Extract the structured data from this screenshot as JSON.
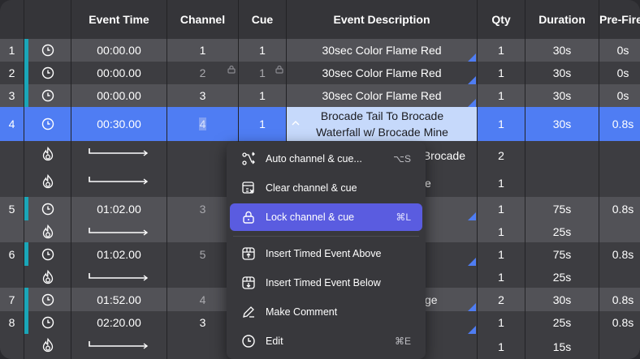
{
  "columns": [
    "",
    "",
    "Event Time",
    "Channel",
    "Cue",
    "Event Description",
    "Qty",
    "Duration",
    "Pre-Fire"
  ],
  "rows": [
    {
      "num": "1",
      "time": "00:00.00",
      "channel": "1",
      "cue": "1",
      "desc": "30sec Color Flame Red",
      "qty": "1",
      "duration": "30s",
      "prefire": "0s"
    },
    {
      "num": "2",
      "time": "00:00.00",
      "channel": "2",
      "cue": "1",
      "desc": "30sec Color Flame Red",
      "qty": "1",
      "duration": "30s",
      "prefire": "0s"
    },
    {
      "num": "3",
      "time": "00:00.00",
      "channel": "3",
      "cue": "1",
      "desc": "30sec Color Flame Red",
      "qty": "1",
      "duration": "30s",
      "prefire": "0s"
    },
    {
      "num": "4",
      "time": "00:30.00",
      "channel": "4",
      "cue": "1",
      "desc_line1": "Brocade Tail To Brocade",
      "desc_line2": "Waterfall w/ Brocade Mine",
      "qty": "1",
      "duration": "30s",
      "prefire": "0.8s"
    },
    {
      "desc": "Brocade",
      "qty": "2"
    },
    {
      "desc": "e",
      "qty": "1"
    },
    {
      "num": "5",
      "time": "01:02.00",
      "channel": "3",
      "qty": "1",
      "duration": "75s",
      "prefire": "0.8s"
    },
    {
      "qty": "1",
      "duration": "25s"
    },
    {
      "num": "6",
      "time": "01:02.00",
      "channel": "5",
      "qty": "1",
      "duration": "75s",
      "prefire": "0.8s"
    },
    {
      "qty": "1",
      "duration": "25s"
    },
    {
      "num": "7",
      "time": "01:52.00",
      "channel": "4",
      "desc": "ge",
      "qty": "2",
      "duration": "30s",
      "prefire": "0.8s"
    },
    {
      "num": "8",
      "time": "02:20.00",
      "channel": "3",
      "qty": "1",
      "duration": "25s",
      "prefire": "0.8s"
    },
    {
      "qty": "1",
      "duration": "15s"
    }
  ],
  "context_menu": {
    "items": [
      {
        "label": "Auto channel & cue...",
        "shortcut": "⌥S",
        "icon": "auto-route-icon"
      },
      {
        "label": "Clear channel & cue",
        "shortcut": "",
        "icon": "clear-table-icon"
      },
      {
        "label": "Lock channel & cue",
        "shortcut": "⌘L",
        "icon": "lock-icon"
      },
      {
        "label": "Insert Timed Event Above",
        "shortcut": "",
        "icon": "insert-above-icon"
      },
      {
        "label": "Insert Timed Event Below",
        "shortcut": "",
        "icon": "insert-below-icon"
      },
      {
        "label": "Make Comment",
        "shortcut": "",
        "icon": "edit-comment-icon"
      },
      {
        "label": "Edit",
        "shortcut": "⌘E",
        "icon": "clock-icon"
      }
    ]
  },
  "colors": {
    "selection": "#4f7df3",
    "menu_highlight": "#5a5ce0",
    "teal_marker": "#1aa6b8"
  }
}
